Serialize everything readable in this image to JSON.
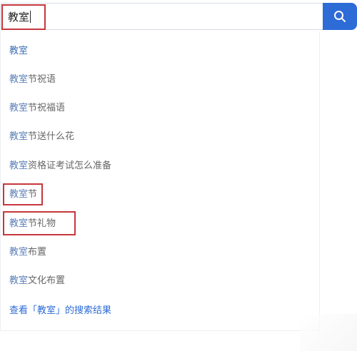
{
  "search": {
    "value": "教室",
    "button_icon": "search-icon"
  },
  "suggestions": [
    {
      "query": "教室",
      "rest": ""
    },
    {
      "query": "教室",
      "rest": "节祝语"
    },
    {
      "query": "教室",
      "rest": "节祝福语"
    },
    {
      "query": "教室",
      "rest": "节送什么花"
    },
    {
      "query": "教室",
      "rest": "资格证考试怎么准备"
    },
    {
      "query": "教室",
      "rest": "节"
    },
    {
      "query": "教室",
      "rest": "节礼物"
    },
    {
      "query": "教室",
      "rest": "布置"
    },
    {
      "query": "教室",
      "rest": "文化布置"
    }
  ],
  "view_all": {
    "text": "查看「教室」的搜索结果"
  },
  "colors": {
    "accent": "#2d6bd7",
    "highlight_border": "#c6373c"
  }
}
